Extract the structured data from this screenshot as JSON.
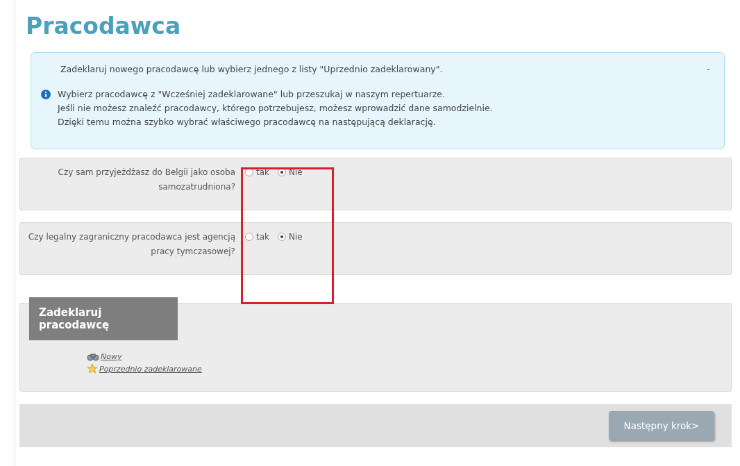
{
  "page_title": "Pracodawca",
  "info": {
    "intro": "Zadeklaruj nowego pracodawcę lub wybierz jednego z listy \"Uprzednio zadeklarowany\".",
    "collapse": "-",
    "lines": [
      "Wybierz pracodawcę z \"Wcześniej zadeklarowane\" lub przeszukaj w naszym repertuarze.",
      "Jeśli nie możesz znaleźć pracodawcy, którego potrzebujesz, możesz wprowadzić dane samodzielnie.",
      "Dzięki temu można szybko wybrać właściwego pracodawcę na następującą deklarację."
    ]
  },
  "questions": [
    {
      "label": "Czy sam przyjeżdżasz do Belgii jako osoba samozatrudniona?",
      "options": [
        {
          "label": "tak",
          "selected": false
        },
        {
          "label": "Nie",
          "selected": true
        }
      ]
    },
    {
      "label": "Czy legalny zagraniczny pracodawca jest agencją pracy tymczasowej?",
      "options": [
        {
          "label": "tak",
          "selected": false
        },
        {
          "label": "Nie",
          "selected": true
        }
      ]
    }
  ],
  "declare": {
    "title": "Zadeklaruj pracodawcę",
    "links": [
      {
        "kind": "binoculars",
        "label": "Nowy"
      },
      {
        "kind": "star",
        "label": "Poprzednio zadeklarowane"
      }
    ]
  },
  "next_button": "Następny krok>"
}
